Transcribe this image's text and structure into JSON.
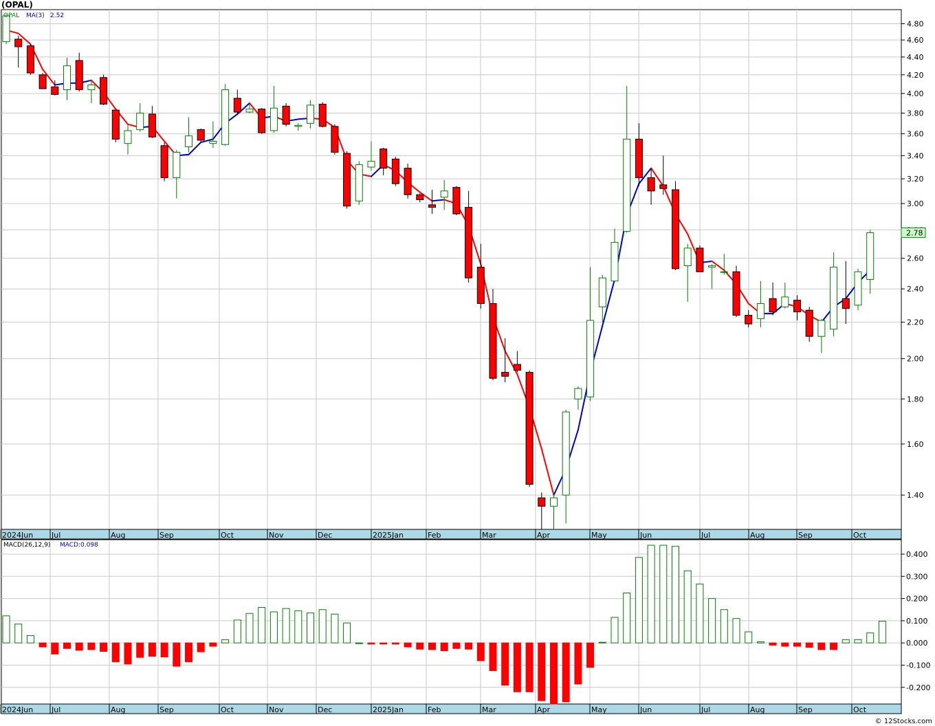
{
  "header": {
    "title": "(OPAL)",
    "footer": "© 12Stocks.com"
  },
  "legend": {
    "symbol": "OPAL",
    "ma_label": "MA(3)",
    "ma_value": "2.52"
  },
  "macd_legend": {
    "label": "MACD(26,12,9)",
    "value_label": "MACD:0.098"
  },
  "last_price_label": "2.78",
  "colors": {
    "up": "#008000",
    "down": "#ff0000",
    "down_fill": "#ff0000",
    "up_fill": "#ffffff",
    "ma_up": "#0000cc",
    "ma_down": "#ff0000",
    "grid": "#c8c8c8",
    "axis_band": "#add8e6",
    "price_box": "#ccffcc"
  },
  "chart_data": [
    {
      "type": "candlestick",
      "title": "(OPAL)",
      "scale": "log",
      "ylim": [
        1.28,
        4.98
      ],
      "yticks": [
        "4.80",
        "4.60",
        "4.40",
        "4.20",
        "4.00",
        "3.80",
        "3.60",
        "3.40",
        "3.20",
        "3.00",
        "2.80",
        "2.60",
        "2.40",
        "2.20",
        "2.00",
        "1.80",
        "1.60",
        "1.40"
      ],
      "x_labels": [
        "2024Jun",
        "Jul",
        "Aug",
        "Sep",
        "Oct",
        "Nov",
        "Dec",
        "2025Jan",
        "Feb",
        "Mar",
        "Apr",
        "May",
        "Jun",
        "Jul",
        "Aug",
        "Sep",
        "Oct"
      ],
      "ohlc": [
        [
          4.58,
          4.92,
          4.55,
          4.9
        ],
        [
          4.61,
          4.65,
          4.28,
          4.52
        ],
        [
          4.53,
          4.55,
          4.2,
          4.22
        ],
        [
          4.2,
          4.22,
          4.05,
          4.05
        ],
        [
          4.07,
          4.14,
          3.98,
          3.99
        ],
        [
          4.04,
          4.39,
          3.93,
          4.3
        ],
        [
          4.36,
          4.45,
          4.02,
          4.04
        ],
        [
          4.04,
          4.13,
          3.9,
          4.09
        ],
        [
          4.17,
          4.2,
          3.88,
          3.89
        ],
        [
          3.83,
          3.84,
          3.52,
          3.55
        ],
        [
          3.51,
          3.68,
          3.41,
          3.63
        ],
        [
          3.64,
          3.9,
          3.62,
          3.8
        ],
        [
          3.79,
          3.87,
          3.56,
          3.57
        ],
        [
          3.49,
          3.52,
          3.18,
          3.21
        ],
        [
          3.21,
          3.45,
          3.04,
          3.43
        ],
        [
          3.48,
          3.76,
          3.43,
          3.58
        ],
        [
          3.64,
          3.65,
          3.52,
          3.54
        ],
        [
          3.51,
          3.72,
          3.47,
          3.53
        ],
        [
          3.5,
          4.1,
          3.49,
          4.04
        ],
        [
          3.95,
          4.04,
          3.78,
          3.81
        ],
        [
          3.81,
          3.9,
          3.8,
          3.84
        ],
        [
          3.84,
          3.85,
          3.6,
          3.61
        ],
        [
          3.63,
          4.08,
          3.61,
          3.85
        ],
        [
          3.87,
          3.9,
          3.67,
          3.69
        ],
        [
          3.67,
          3.7,
          3.63,
          3.68
        ],
        [
          3.7,
          3.93,
          3.65,
          3.88
        ],
        [
          3.89,
          3.91,
          3.66,
          3.67
        ],
        [
          3.67,
          3.69,
          3.41,
          3.43
        ],
        [
          3.42,
          3.44,
          2.96,
          2.98
        ],
        [
          3.02,
          3.35,
          2.99,
          3.32
        ],
        [
          3.3,
          3.53,
          3.27,
          3.35
        ],
        [
          3.46,
          3.47,
          3.23,
          3.29
        ],
        [
          3.37,
          3.39,
          3.14,
          3.16
        ],
        [
          3.29,
          3.33,
          3.04,
          3.07
        ],
        [
          3.07,
          3.08,
          3.01,
          3.03
        ],
        [
          2.99,
          3.11,
          2.92,
          2.97
        ],
        [
          3.05,
          3.19,
          2.95,
          3.1
        ],
        [
          3.13,
          3.14,
          2.91,
          2.92
        ],
        [
          2.97,
          3.1,
          2.44,
          2.47
        ],
        [
          2.54,
          2.7,
          2.28,
          2.31
        ],
        [
          2.31,
          2.4,
          1.89,
          1.9
        ],
        [
          1.93,
          2.11,
          1.88,
          1.91
        ],
        [
          1.97,
          2.04,
          1.93,
          1.94
        ],
        [
          1.93,
          1.94,
          1.43,
          1.44
        ],
        [
          1.39,
          1.41,
          1.22,
          1.36
        ],
        [
          1.36,
          1.41,
          1.22,
          1.39
        ],
        [
          1.4,
          1.75,
          1.3,
          1.74
        ],
        [
          1.8,
          1.86,
          1.75,
          1.85
        ],
        [
          1.81,
          2.54,
          1.79,
          2.21
        ],
        [
          2.29,
          2.49,
          2.2,
          2.47
        ],
        [
          2.45,
          2.81,
          2.44,
          2.71
        ],
        [
          2.79,
          4.08,
          2.78,
          3.55
        ],
        [
          3.55,
          3.7,
          3.14,
          3.21
        ],
        [
          3.21,
          3.29,
          2.99,
          3.1
        ],
        [
          3.15,
          3.4,
          3.07,
          3.12
        ],
        [
          3.11,
          3.18,
          2.52,
          2.53
        ],
        [
          2.55,
          2.7,
          2.32,
          2.67
        ],
        [
          2.67,
          2.69,
          2.51,
          2.51
        ],
        [
          2.54,
          2.56,
          2.4,
          2.55
        ],
        [
          2.51,
          2.63,
          2.49,
          2.51
        ],
        [
          2.51,
          2.55,
          2.23,
          2.24
        ],
        [
          2.24,
          2.27,
          2.17,
          2.19
        ],
        [
          2.22,
          2.45,
          2.17,
          2.31
        ],
        [
          2.34,
          2.44,
          2.24,
          2.26
        ],
        [
          2.29,
          2.44,
          2.28,
          2.35
        ],
        [
          2.33,
          2.36,
          2.21,
          2.26
        ],
        [
          2.27,
          2.29,
          2.09,
          2.12
        ],
        [
          2.12,
          2.22,
          2.03,
          2.21
        ],
        [
          2.16,
          2.64,
          2.12,
          2.54
        ],
        [
          2.34,
          2.58,
          2.19,
          2.28
        ],
        [
          2.3,
          2.53,
          2.27,
          2.51
        ],
        [
          2.46,
          2.8,
          2.37,
          2.78
        ]
      ],
      "ma3": [
        4.72,
        4.68,
        4.55,
        4.26,
        4.09,
        4.11,
        4.11,
        4.14,
        4.01,
        3.84,
        3.69,
        3.66,
        3.67,
        3.53,
        3.4,
        3.41,
        3.52,
        3.55,
        3.7,
        3.79,
        3.9,
        3.75,
        3.77,
        3.72,
        3.74,
        3.75,
        3.74,
        3.66,
        3.36,
        3.24,
        3.22,
        3.32,
        3.27,
        3.17,
        3.09,
        3.02,
        3.03,
        3.0,
        2.83,
        2.56,
        2.23,
        2.04,
        1.92,
        1.76,
        1.58,
        1.4,
        1.5,
        1.66,
        1.93,
        2.18,
        2.46,
        2.91,
        3.16,
        3.29,
        3.14,
        2.92,
        2.77,
        2.57,
        2.58,
        2.52,
        2.43,
        2.31,
        2.25,
        2.25,
        2.31,
        2.29,
        2.24,
        2.2,
        2.29,
        2.34,
        2.44,
        2.52
      ]
    },
    {
      "type": "bar",
      "title": "MACD(26,12,9)",
      "ylim": [
        -0.275,
        0.465
      ],
      "yticks": [
        "0.400",
        "0.300",
        "0.200",
        "0.100",
        "0.000",
        "-0.100",
        "-0.200"
      ],
      "x_labels": [
        "2024Jun",
        "Jul",
        "Aug",
        "Sep",
        "Oct",
        "Nov",
        "Dec",
        "2025Jan",
        "Feb",
        "Mar",
        "Apr",
        "May",
        "Jun",
        "Jul",
        "Aug",
        "Sep",
        "Oct"
      ],
      "values": [
        0.122,
        0.085,
        0.033,
        -0.018,
        -0.05,
        -0.025,
        -0.033,
        -0.03,
        -0.038,
        -0.085,
        -0.095,
        -0.065,
        -0.06,
        -0.063,
        -0.105,
        -0.085,
        -0.04,
        -0.015,
        0.015,
        0.103,
        0.133,
        0.16,
        0.14,
        0.155,
        0.145,
        0.135,
        0.15,
        0.13,
        0.09,
        0.0,
        -0.005,
        -0.005,
        -0.005,
        -0.018,
        -0.028,
        -0.03,
        -0.035,
        -0.025,
        -0.028,
        -0.08,
        -0.125,
        -0.19,
        -0.22,
        -0.22,
        -0.26,
        -0.275,
        -0.265,
        -0.185,
        -0.11,
        0.003,
        0.115,
        0.225,
        0.385,
        0.44,
        0.44,
        0.435,
        0.325,
        0.265,
        0.2,
        0.15,
        0.11,
        0.05,
        0.005,
        -0.01,
        -0.015,
        -0.015,
        -0.02,
        -0.03,
        -0.03,
        0.015,
        0.015,
        0.045,
        0.098
      ]
    }
  ]
}
